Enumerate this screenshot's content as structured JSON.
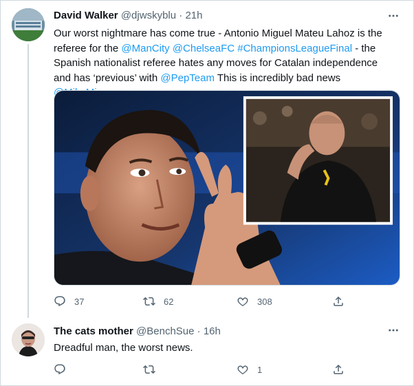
{
  "tweets": [
    {
      "author_name": "David Walker",
      "handle": "@djwskyblu",
      "separator": "·",
      "time": "21h",
      "text_segments": [
        "Our worst nightmare has come true - Antonio Miguel Mateu Lahoz is the referee for the ",
        "@ManCity",
        " ",
        "@ChelseaFC",
        " ",
        "#ChampionsLeagueFinal",
        " - the Spanish nationalist referee hates any moves for Catalan independence and has ‘previous’ with ",
        "@PepTeam",
        " This is incredibly bad news ",
        "@MikeMinay"
      ],
      "counts": {
        "replies": "37",
        "retweets": "62",
        "likes": "308"
      },
      "media_icons": [
        "referee-photo",
        "inset-manager-photo"
      ]
    },
    {
      "author_name": "The cats mother",
      "handle": "@BenchSue",
      "separator": "·",
      "time": "16h",
      "text": "Dreadful man, the worst news.",
      "counts": {
        "replies": "",
        "retweets": "",
        "likes": "1"
      }
    }
  ],
  "icons": {
    "reply": "reply-icon",
    "retweet": "retweet-icon",
    "like": "heart-icon",
    "share": "share-icon",
    "more": "more-icon"
  },
  "colors": {
    "link": "#1d9bf0",
    "secondary_text": "#536471",
    "primary_text": "#0f1419",
    "border": "#cfd9de"
  }
}
